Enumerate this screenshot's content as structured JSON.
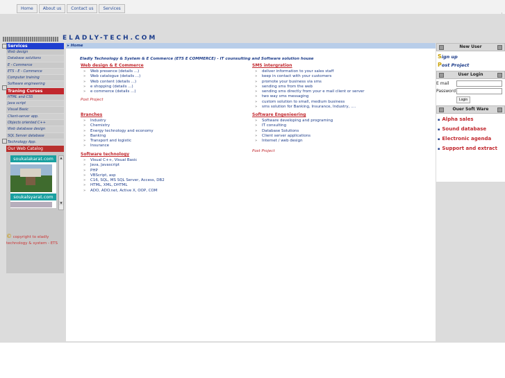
{
  "top_nav": [
    "Home",
    "About us",
    "Contact us",
    "Services"
  ],
  "logo_text": "ELADLY-TECH.COM",
  "left": {
    "services_header": "Services",
    "services": [
      "Web design",
      "Database solutions",
      "E - Commerce",
      "ETS - E - Commerce",
      "Computer training",
      "Software engineering"
    ],
    "training_header": "Traning Curses",
    "training": [
      "HTML and CSS",
      "Java script",
      "Visual Basic",
      "Client-server app.",
      "Objects oriented C++",
      "Web database design",
      "SQL Server database",
      "Technology App."
    ],
    "catalog_header": "Our Web Catalog",
    "catalog_label_1": "soukalakarat.com",
    "catalog_label_2": "soukalsyarat.com",
    "copyright_symbol": "©",
    "copyright": "copyright to eladly technology & system - ETS"
  },
  "main": {
    "breadcrumb": "Home",
    "tagline": "Eladly Technology & System & E Commerce (ETS E COMMERCE)  -  IT counsulting and Software solution house",
    "webdesign": {
      "heading": "Web design & E Commerce",
      "items": [
        "Web presence (details ...)",
        "Web catalogue  (details ...)",
        "Web content  (details ...)",
        " e shopping  (details ...)",
        "e commerce (details ...)"
      ],
      "post": "Post Project"
    },
    "sms": {
      "heading": "SMS intergration",
      "items": [
        "deliver information to your sales staff",
        "keep in contact with your customers",
        "promote your business via sms",
        "sending sms from the web",
        "sending sms directly from your e mail client or server",
        "two way sms messaging",
        "custom solution to small, medium business",
        "sms solution for Banking, Insurance, Industry, ...."
      ]
    },
    "branches": {
      "heading": "Branches",
      "items": [
        "Industry",
        "Chemistry",
        "Energy technology and economy",
        "Banking",
        "Transport and logistic",
        "Insurance"
      ]
    },
    "softeng": {
      "heading": "Software Engenieering",
      "items": [
        "Software developing and programing",
        "IT consulting",
        "Database Solutions",
        "Client server applications",
        "Internet / web design"
      ],
      "post": "Post Project"
    },
    "softtech": {
      "heading": "Software technology",
      "items": [
        "Visual C++, Visual Basic",
        "Java, Javascript",
        "PHP",
        "VBScript, asp",
        "C16, SQL, MS SQL Server, Access, DB2",
        "HTML, XML, DHTML",
        "ADO, ADO.net, Active X, OOP, COM"
      ]
    }
  },
  "right": {
    "new_user_header": "New User",
    "signup_cap": "S",
    "signup": "ign up",
    "post_cap": "P",
    "post": "ost Project",
    "login_header": "User Login",
    "email_label": "E mail",
    "password_label": "Password",
    "login_button": "Login",
    "software_header": "Ouer Soft Ware",
    "software": [
      "Alpha sales",
      "Sound database",
      "Electronic agenda",
      "Support and extract"
    ]
  }
}
